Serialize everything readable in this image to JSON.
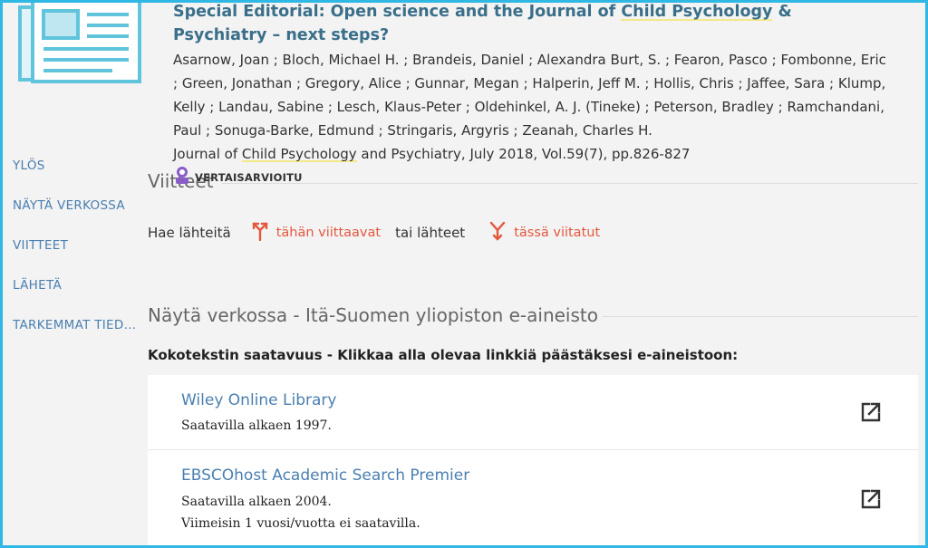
{
  "record": {
    "title_part1": "Special Editorial: Open science and the Journal of ",
    "title_highlight": "Child Psychology",
    "title_part2": " & Psychiatry – next steps?",
    "authors": "Asarnow, Joan ; Bloch, Michael H. ; Brandeis, Daniel ; Alexandra Burt, S. ; Fearon, Pasco ; Fombonne, Eric ; Green, Jonathan ; Gregory, Alice ; Gunnar, Megan ; Halperin, Jeff M. ; Hollis, Chris ; Jaffee, Sara ; Klump, Kelly ; Landau, Sabine ; Lesch, Klaus-Peter ; Oldehinkel, A. J. (Tineke) ; Peterson, Bradley ; Ramchandani, Paul ; Sonuga-Barke, Edmund ; Stringaris, Argyris ; Zeanah, Charles H.",
    "source_prefix": "Journal of ",
    "source_highlight": "Child Psychology",
    "source_suffix": " and Psychiatry, July 2018, Vol.59(7), pp.826-827",
    "peer_reviewed": "VERTAISARVIOITU"
  },
  "sidenav": {
    "items": [
      "YLÖS",
      "NÄYTÄ VERKOSSA",
      "VIITTEET",
      "LÄHETÄ",
      "TARKEMMAT TIEDOT"
    ]
  },
  "references": {
    "title": "Viitteet",
    "prefix": "Hae lähteitä",
    "citing_label": "tähän viittaavat",
    "middle": "tai lähteet",
    "cited_label": "tässä viitatut"
  },
  "online": {
    "title": "Näytä verkossa - Itä-Suomen yliopiston e-aineisto",
    "availability_heading": "Kokotekstin saatavuus - Klikkaa alla olevaa linkkiä päästäksesi e-aineistoon:",
    "services": [
      {
        "name": "Wiley Online Library",
        "note1": "Saatavilla alkaen 1997.",
        "note2": ""
      },
      {
        "name": "EBSCOhost Academic Search Premier",
        "note1": "Saatavilla alkaen 2004.",
        "note2": "Viimeisin 1 vuosi/vuotta ei saatavilla."
      }
    ]
  },
  "colors": {
    "link": "#4a7fb0",
    "title": "#3a6f8a",
    "accent": "#e4573d",
    "highlight": "#f3e88a",
    "frame": "#2fb8e3",
    "peer_icon": "#8a5cc7"
  },
  "icons": [
    "newspaper-icon",
    "peer-reviewed-icon",
    "citing-arrows-icon",
    "cited-arrows-icon",
    "external-link-icon"
  ]
}
